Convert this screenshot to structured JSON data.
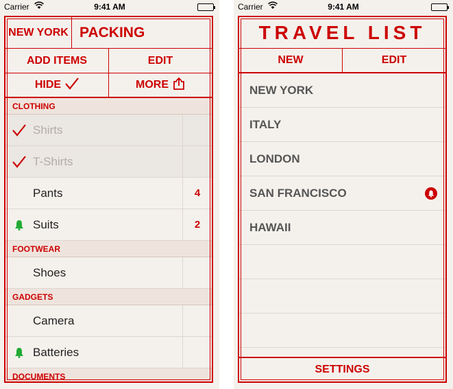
{
  "status_bar": {
    "carrier": "Carrier",
    "time": "9:41 AM"
  },
  "packing": {
    "city": "NEW YORK",
    "title": "PACKING",
    "add_items_label": "ADD ITEMS",
    "edit_label": "EDIT",
    "hide_label": "HIDE",
    "more_label": "MORE",
    "sections": [
      {
        "name": "CLOTHING",
        "items": [
          {
            "label": "Shirts",
            "checked": true,
            "reminder": false,
            "count": ""
          },
          {
            "label": "T-Shirts",
            "checked": true,
            "reminder": false,
            "count": ""
          },
          {
            "label": "Pants",
            "checked": false,
            "reminder": false,
            "count": "4"
          },
          {
            "label": "Suits",
            "checked": false,
            "reminder": true,
            "count": "2"
          }
        ]
      },
      {
        "name": "FOOTWEAR",
        "items": [
          {
            "label": "Shoes",
            "checked": false,
            "reminder": false,
            "count": ""
          }
        ]
      },
      {
        "name": "GADGETS",
        "items": [
          {
            "label": "Camera",
            "checked": false,
            "reminder": false,
            "count": ""
          },
          {
            "label": "Batteries",
            "checked": false,
            "reminder": true,
            "count": ""
          }
        ]
      },
      {
        "name": "DOCUMENTS",
        "items": []
      }
    ]
  },
  "travel_list": {
    "title": "TRAVEL LIST",
    "new_label": "NEW",
    "edit_label": "EDIT",
    "trips": [
      {
        "label": "NEW YORK",
        "alert": false
      },
      {
        "label": "ITALY",
        "alert": false
      },
      {
        "label": "LONDON",
        "alert": false
      },
      {
        "label": "SAN FRANCISCO",
        "alert": true
      },
      {
        "label": "HAWAII",
        "alert": false
      }
    ],
    "settings_label": "SETTINGS"
  },
  "icons": {
    "check": "check-icon",
    "bell": "bell-icon",
    "share": "share-icon",
    "alert": "alert-icon"
  },
  "colors": {
    "accent": "#cc0000",
    "bell": "#22aa33",
    "background": "#f4f1ec"
  }
}
